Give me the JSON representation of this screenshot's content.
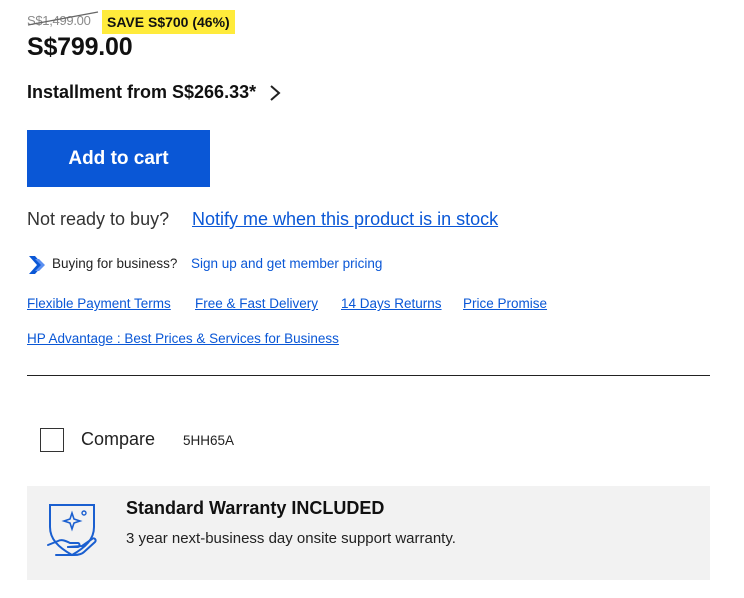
{
  "pricing": {
    "old_price": "S$1,499.00",
    "save_badge": "SAVE S$700 (46%)",
    "new_price": "S$799.00",
    "installment": "Installment from S$266.33*"
  },
  "cart": {
    "add_to_cart": "Add to cart"
  },
  "stock": {
    "not_ready": "Not ready to buy?",
    "notify": "Notify me when this product is in stock"
  },
  "business": {
    "label": "Buying for business?",
    "link": "Sign up and get member pricing"
  },
  "features": [
    "Flexible Payment Terms",
    "Free & Fast Delivery",
    "14 Days Returns",
    "Price Promise"
  ],
  "advantage_link": "HP Advantage : Best Prices & Services for Business",
  "compare": {
    "label": "Compare",
    "sku": "5HH65A"
  },
  "warranty": {
    "title": "Standard Warranty INCLUDED",
    "desc": "3 year next-business day onsite support warranty."
  },
  "colors": {
    "accent_blue": "#0a57d6",
    "badge_yellow": "#ffeb3b",
    "card_gray": "#f2f2f2"
  },
  "icons": {
    "installment_chevron": "chevron-right-icon",
    "business": "double-chevron-icon",
    "warranty": "shield-hand-icon"
  }
}
